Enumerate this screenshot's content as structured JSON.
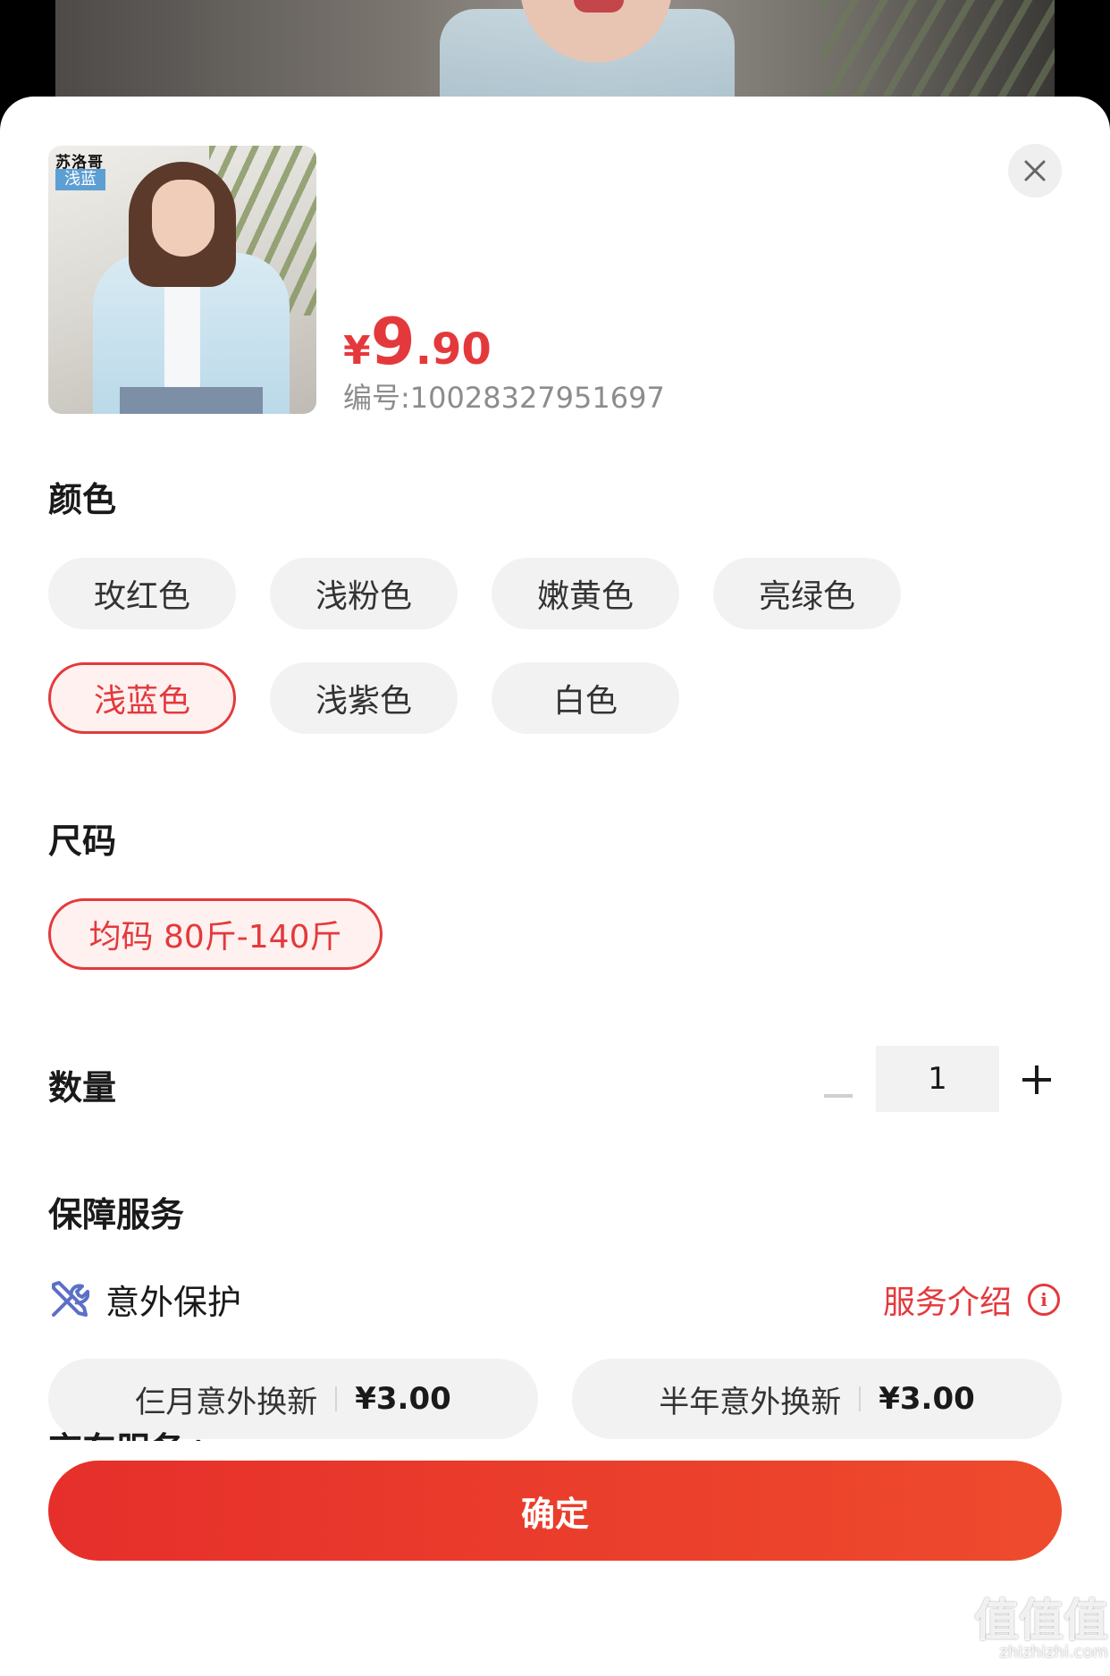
{
  "product": {
    "thumb_logo": "苏洛哥",
    "thumb_color_tag": "浅蓝",
    "price_currency": "¥",
    "price_integer": "9",
    "price_decimal": ".90",
    "sku_label": "编号:10028327951697"
  },
  "color": {
    "title": "颜色",
    "options": [
      "玫红色",
      "浅粉色",
      "嫩黄色",
      "亮绿色",
      "浅蓝色",
      "浅紫色",
      "白色"
    ],
    "selected": "浅蓝色"
  },
  "size": {
    "title": "尺码",
    "options": [
      "均码 80斤-140斤"
    ],
    "selected": "均码 80斤-140斤"
  },
  "quantity": {
    "title": "数量",
    "value": "1"
  },
  "protection": {
    "title": "保障服务",
    "item_label": "意外保护",
    "intro_link": "服务介绍",
    "info_glyph": "i",
    "options": [
      {
        "name": "仨月意外换新",
        "price": "¥3.00"
      },
      {
        "name": "半年意外换新",
        "price": "¥3.00"
      }
    ]
  },
  "jd_service_title": "京东服务+",
  "confirm_label": "确定",
  "watermark": {
    "text": "值值值",
    "sub": "zhizhizhi.com"
  },
  "colors": {
    "accent": "#e4393c",
    "pill_bg": "#f2f2f2",
    "selected_bg": "#fef1f0"
  },
  "icons": [
    "close-icon",
    "tools-icon",
    "info-icon",
    "minus-icon",
    "plus-icon"
  ]
}
